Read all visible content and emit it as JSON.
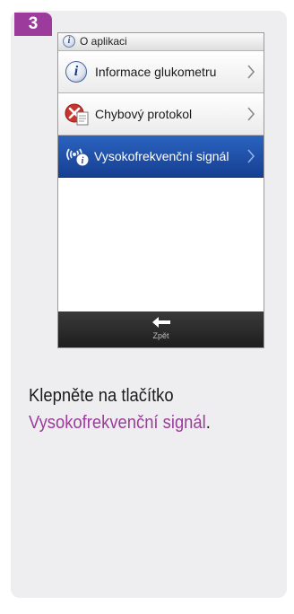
{
  "step": {
    "number": "3"
  },
  "device": {
    "title": "O aplikaci",
    "menu": [
      {
        "label": "Informace glukometru",
        "icon": "info-icon",
        "selected": false
      },
      {
        "label": "Chybový protokol",
        "icon": "error-log-icon",
        "selected": false
      },
      {
        "label": "Vysokofrekvenční signál",
        "icon": "signal-info-icon",
        "selected": true
      }
    ],
    "back_label": "Zpět"
  },
  "instruction": {
    "prefix": "Klepněte na tlačítko",
    "highlight": "Vysokofrekvenční signál",
    "suffix": "."
  },
  "colors": {
    "accent": "#9c3b9b",
    "selected_row": "#1f4fa8",
    "bottom_bar": "#2a2a2a",
    "card_background": "#eeeef0"
  }
}
